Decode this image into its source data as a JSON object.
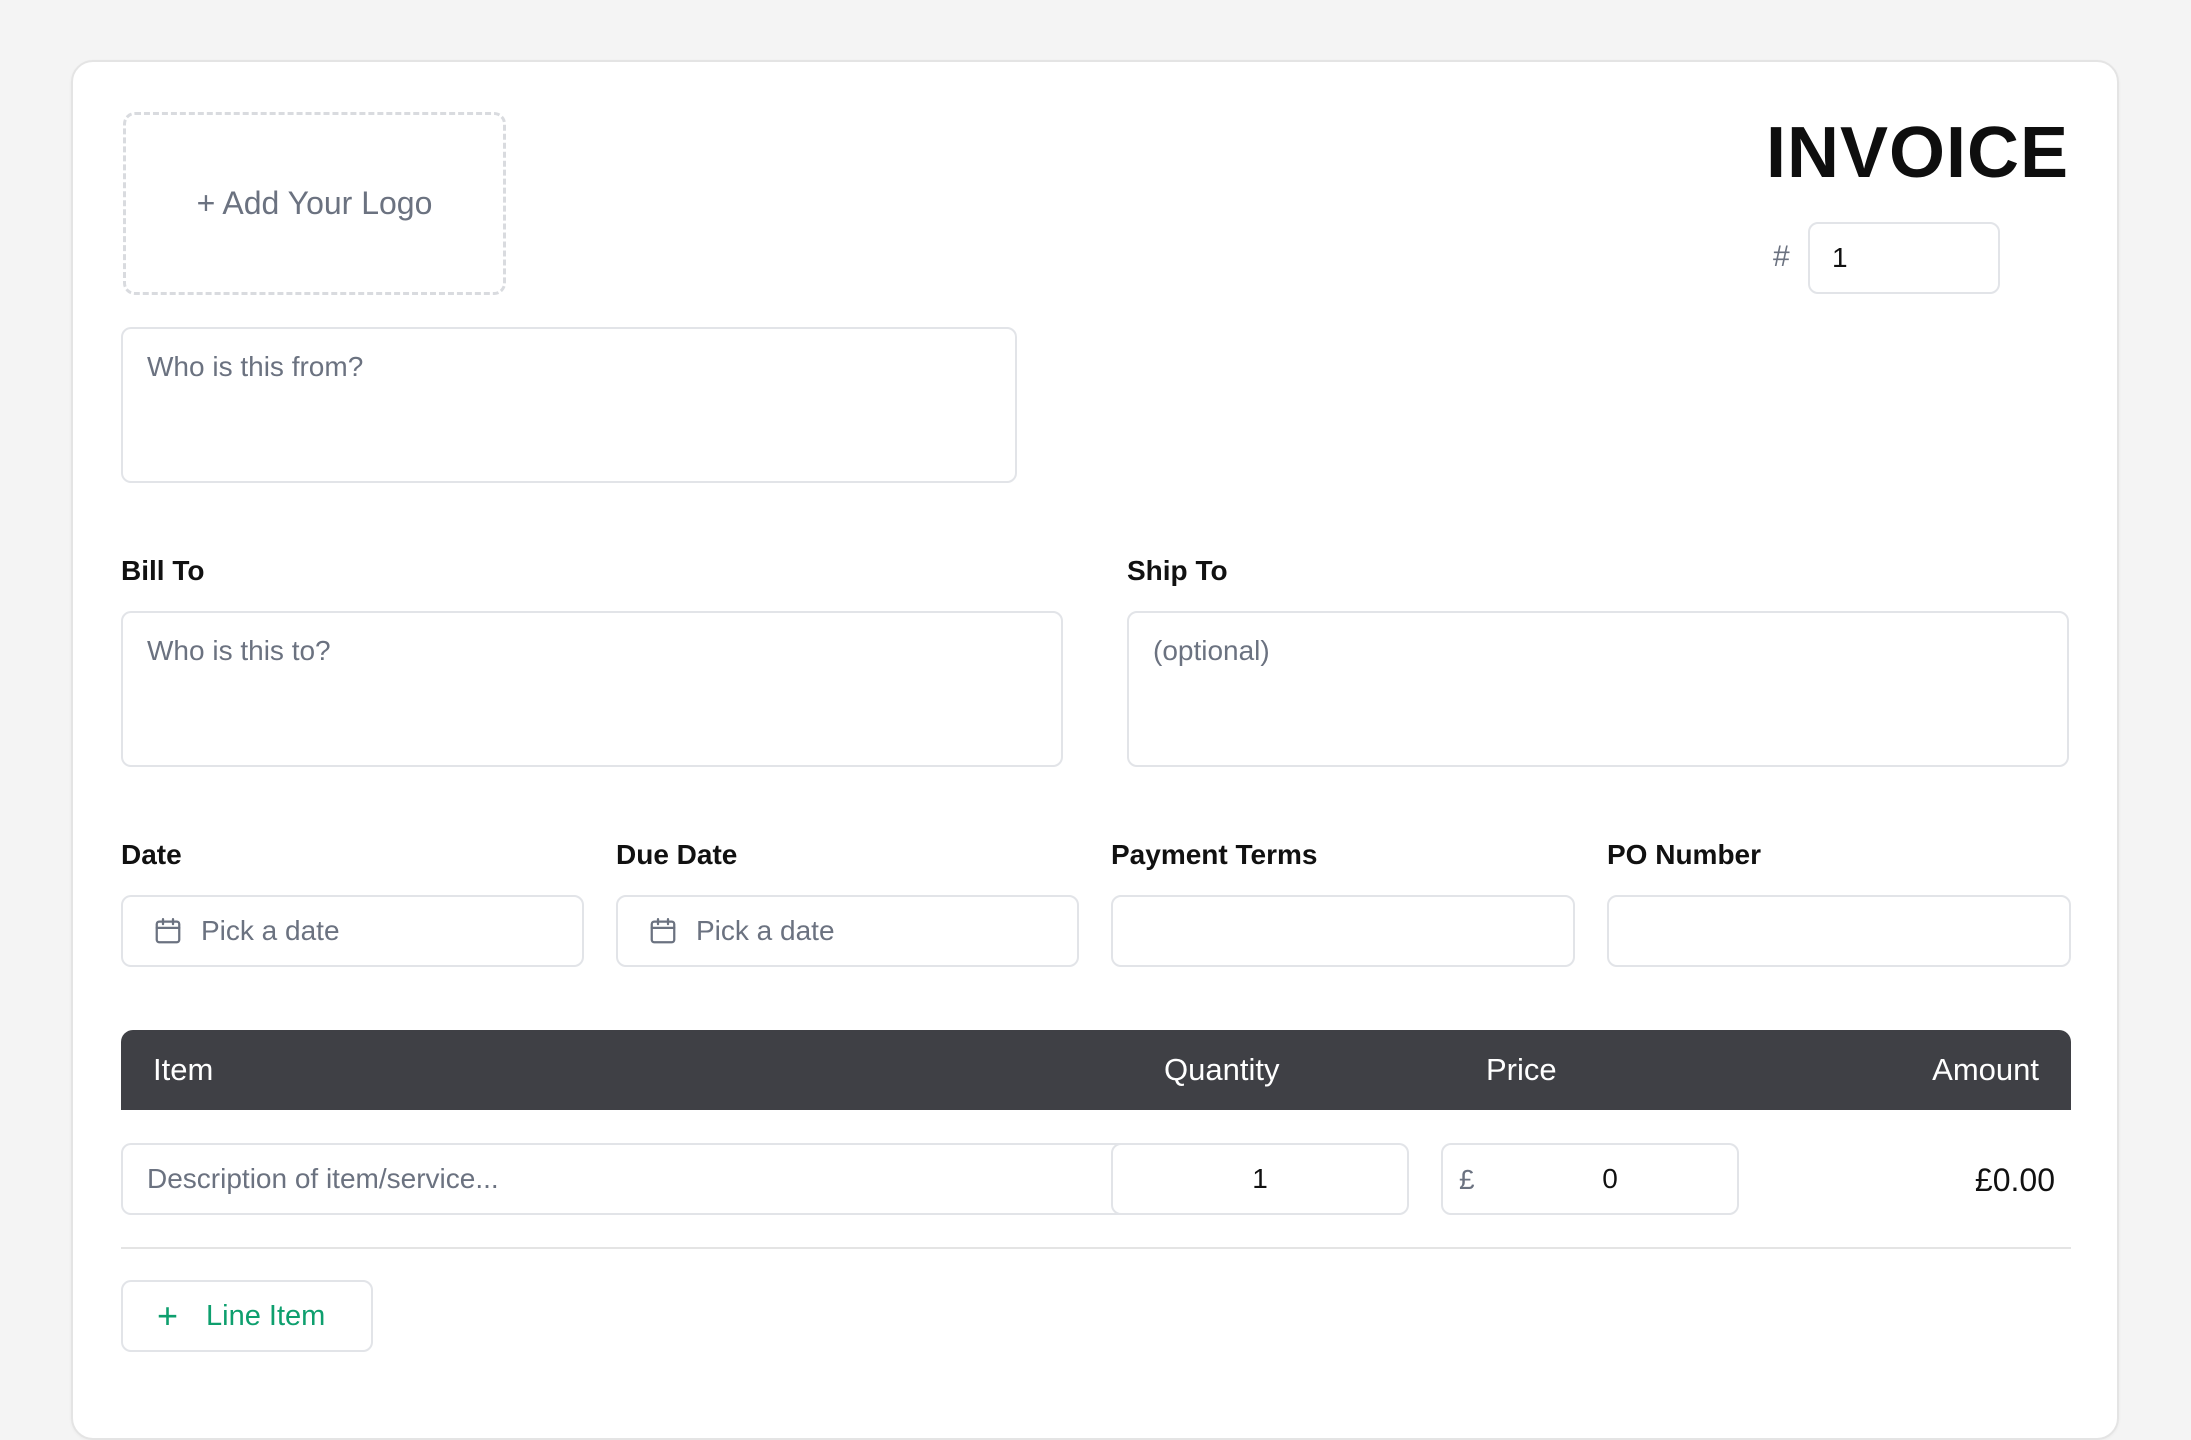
{
  "logo": {
    "label": "+ Add Your Logo"
  },
  "header": {
    "title": "INVOICE",
    "number_prefix": "#",
    "number_value": "1"
  },
  "from": {
    "placeholder": "Who is this from?"
  },
  "bill_to": {
    "label": "Bill To",
    "placeholder": "Who is this to?"
  },
  "ship_to": {
    "label": "Ship To",
    "placeholder": "(optional)"
  },
  "dates": {
    "date_label": "Date",
    "date_placeholder": "Pick a date",
    "due_label": "Due Date",
    "due_placeholder": "Pick a date",
    "terms_label": "Payment Terms",
    "terms_value": "",
    "po_label": "PO Number",
    "po_value": ""
  },
  "table": {
    "columns": [
      "Item",
      "Quantity",
      "Price",
      "Amount"
    ],
    "rows": [
      {
        "description_placeholder": "Description of item/service...",
        "quantity": "1",
        "currency": "£",
        "price": "0",
        "amount": "£0.00"
      }
    ]
  },
  "actions": {
    "add_line_label": "Line Item",
    "add_line_icon": "plus-icon"
  },
  "colors": {
    "accent": "#0e9f6e",
    "table_header": "#3f4045",
    "border": "#e2e4e8"
  }
}
